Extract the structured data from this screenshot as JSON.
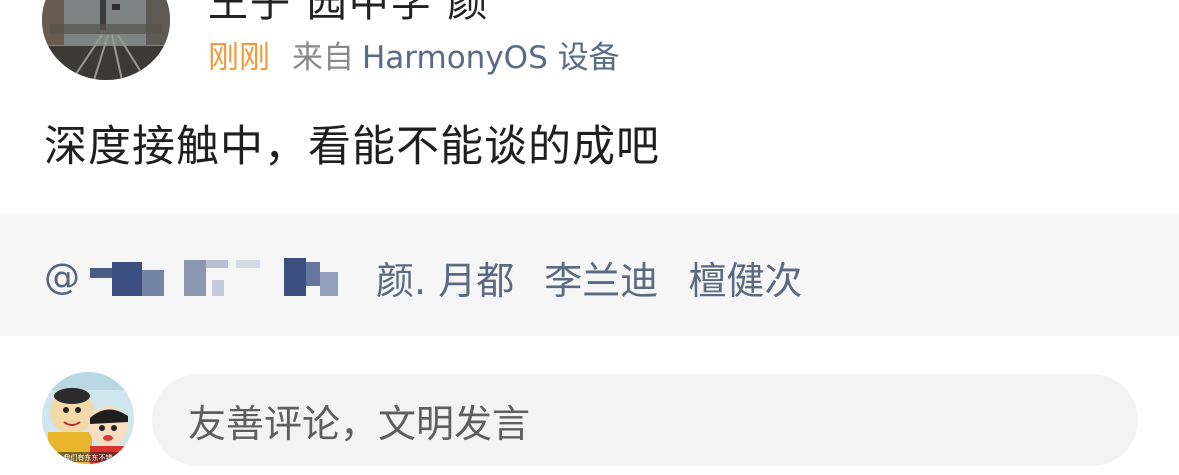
{
  "post": {
    "author_name_partial": "王子 园中学 颜",
    "time": "刚刚",
    "from_label": "来自",
    "device": "HarmonyOS 设备",
    "text": "深度接触中，看能不能谈的成吧"
  },
  "mentions": {
    "at": "@",
    "partial_suffix": "颜.",
    "names": [
      "月都",
      "李兰迪",
      "檀健次"
    ]
  },
  "comment": {
    "placeholder": "友善评论，文明发言",
    "avatar_caption": "我们有东东不错"
  },
  "colors": {
    "time": "#f09a3a",
    "device": "#596b86",
    "mention": "#55657e",
    "mention_bg": "#f6f6f6",
    "input_bg": "#f3f3f3"
  }
}
